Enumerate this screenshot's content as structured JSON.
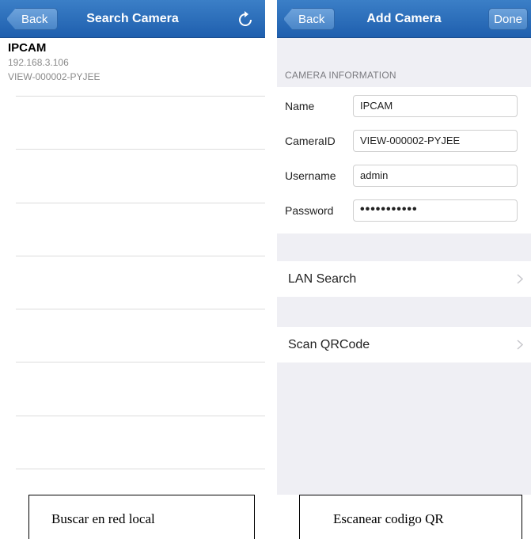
{
  "left": {
    "nav": {
      "back_label": "Back",
      "title": "Search Camera",
      "refresh_icon": "refresh-icon"
    },
    "devices": [
      {
        "name": "IPCAM",
        "ip": "192.168.3.106",
        "id": "VIEW-000002-PYJEE"
      }
    ]
  },
  "right": {
    "nav": {
      "back_label": "Back",
      "title": "Add Camera",
      "done_label": "Done"
    },
    "section_header": "CAMERA INFORMATION",
    "fields": {
      "name": {
        "label": "Name",
        "value": "IPCAM"
      },
      "camera_id": {
        "label": "CameraID",
        "value": "VIEW-000002-PYJEE"
      },
      "username": {
        "label": "Username",
        "value": "admin"
      },
      "password": {
        "label": "Password",
        "value": "•••••••••••"
      }
    },
    "lan_search_label": "LAN Search",
    "scan_qr_label": "Scan QRCode"
  },
  "captions": {
    "left": "Buscar en red local",
    "right": "Escanear codigo QR"
  },
  "colors": {
    "nav_bar": "#2a6db8",
    "grouped_background": "#efeff4"
  }
}
